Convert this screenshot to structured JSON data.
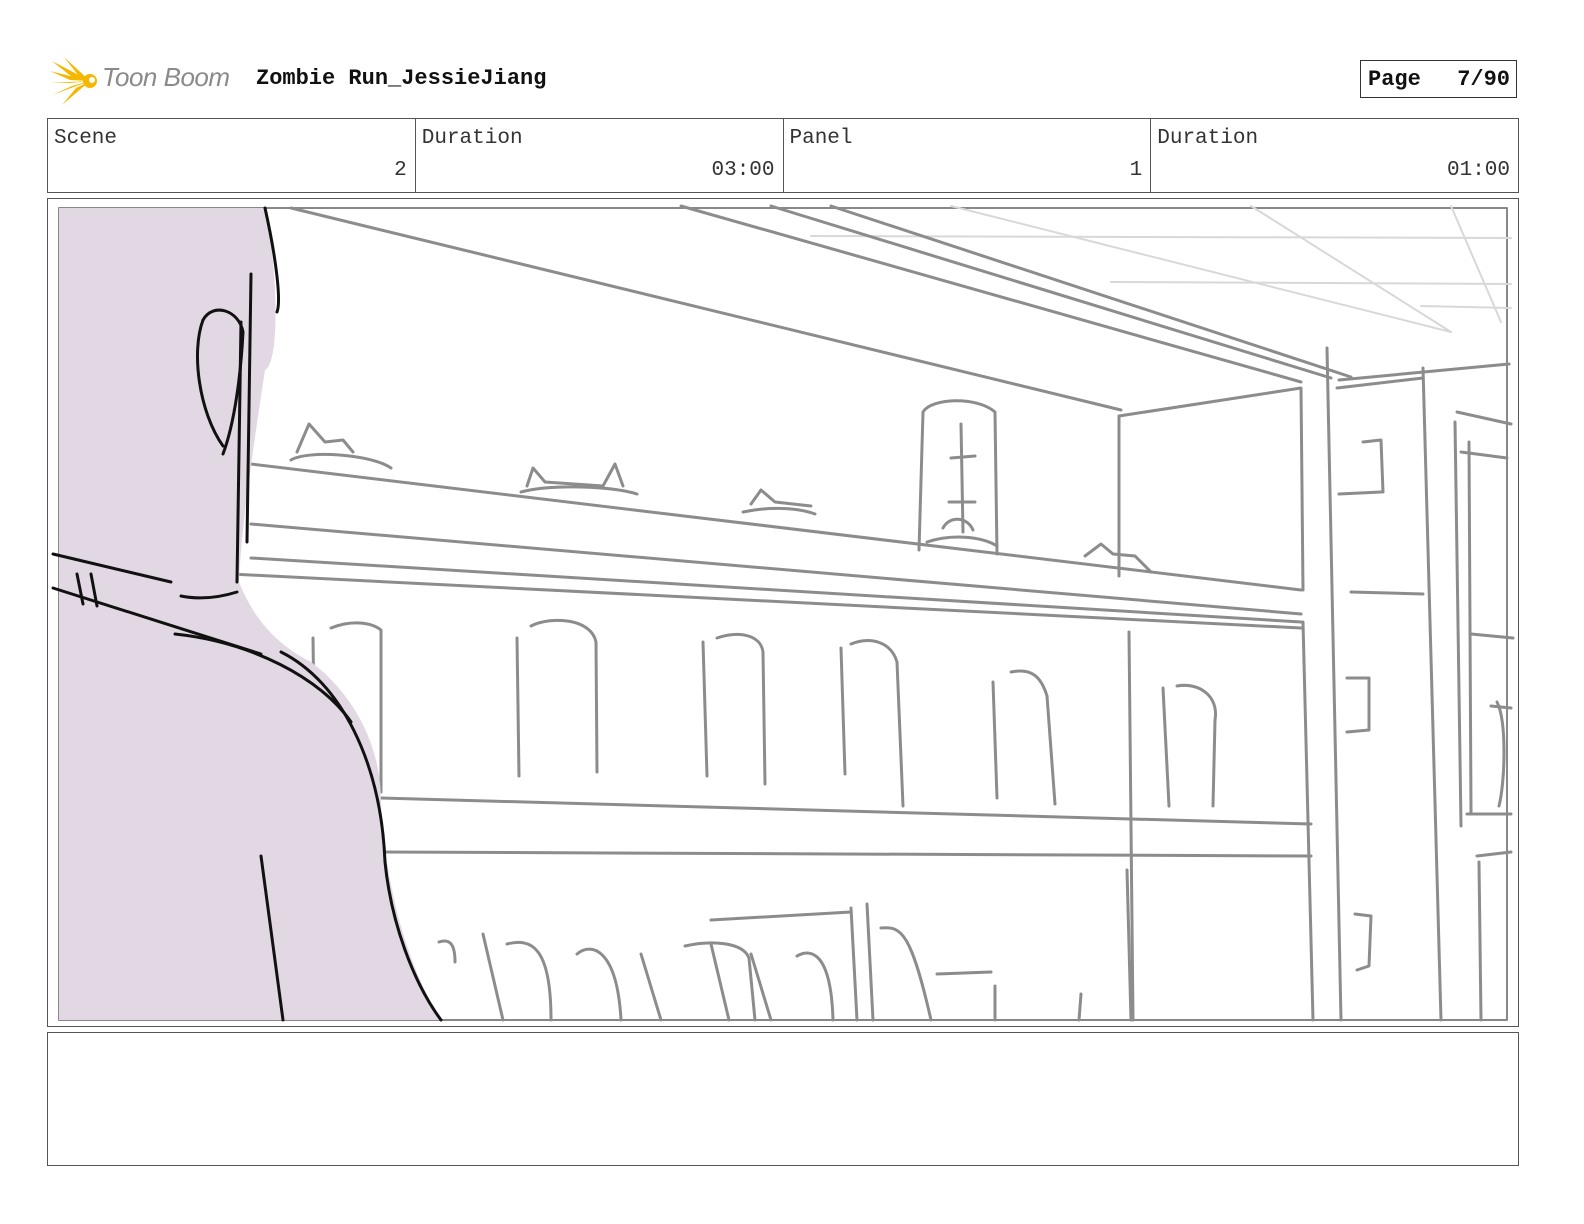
{
  "brand": {
    "logo_text": "Toon Boom",
    "logo_icon": "sun-burst-icon",
    "accent_color": "#f5b800"
  },
  "header": {
    "project_title": "Zombie Run_JessieJiang",
    "page_label": "Page",
    "page_value": "7/90"
  },
  "info": {
    "scene_label": "Scene",
    "scene_value": "2",
    "scene_duration_label": "Duration",
    "scene_duration_value": "03:00",
    "panel_label": "Panel",
    "panel_value": "1",
    "panel_duration_label": "Duration",
    "panel_duration_value": "01:00"
  },
  "panel": {
    "character_fill_color": "#e2d8e3",
    "sketch_color": "#8c8c8c"
  },
  "caption": {
    "text": ""
  }
}
